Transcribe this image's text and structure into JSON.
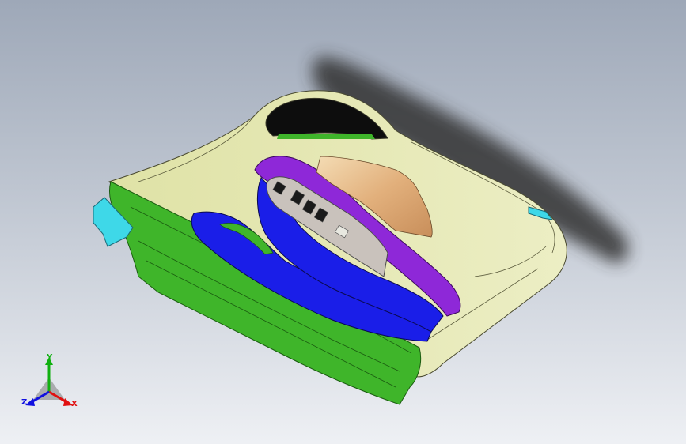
{
  "view": {
    "background_top": "#9ea8b8",
    "background_bottom": "#eef0f4"
  },
  "model": {
    "part": "door-trim-panel",
    "colors": {
      "main_surface": "#e4e6ae",
      "edge_band": "#3fb52a",
      "armrest": "#1a1ee8",
      "handle_grip": "#8e28d8",
      "wood_insert": "#e8c89a",
      "switch_bezel": "#c9c2bc",
      "clip_cyan": "#3ed8e8"
    }
  },
  "triad": {
    "x_label": "X",
    "y_label": "Y",
    "z_label": "Z",
    "x_color": "#e01010",
    "y_color": "#10b010",
    "z_color": "#1010e0"
  }
}
